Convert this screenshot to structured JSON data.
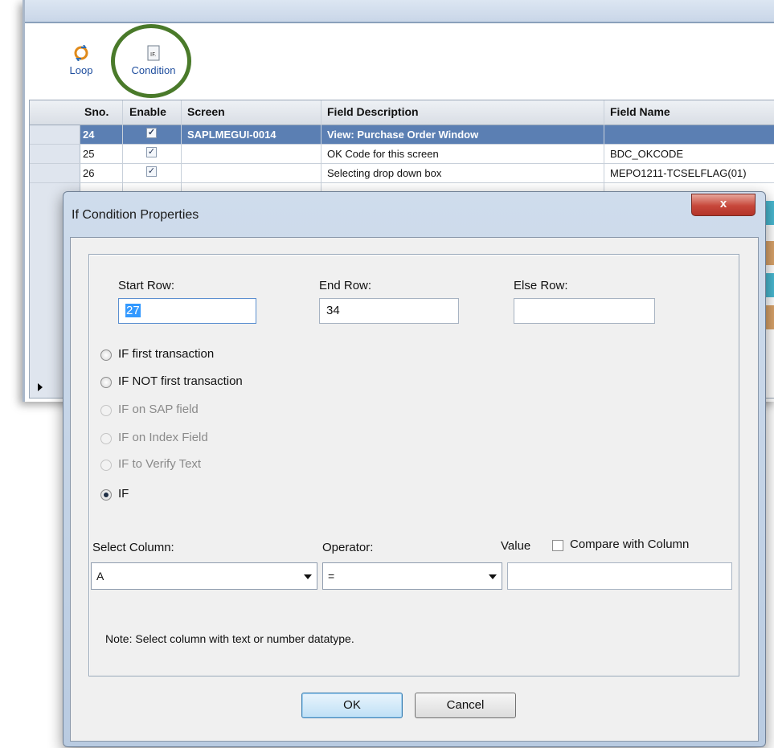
{
  "toolbar": {
    "loop_label": "Loop",
    "condition_label": "Condition"
  },
  "grid": {
    "headers": {
      "sno": "Sno.",
      "enable": "Enable",
      "screen": "Screen",
      "field_description": "Field Description",
      "field_name": "Field Name"
    },
    "rows": [
      {
        "sno": "24",
        "screen": "SAPLMEGUI-0014",
        "field_description": "View: Purchase Order Window",
        "field_name": ""
      },
      {
        "sno": "25",
        "screen": "",
        "field_description": "OK Code for this screen",
        "field_name": "BDC_OKCODE"
      },
      {
        "sno": "26",
        "screen": "",
        "field_description": "Selecting drop down box",
        "field_name": "MEPO1211-TCSELFLAG(01)"
      }
    ]
  },
  "dialog": {
    "title": "If Condition Properties",
    "close_label": "x",
    "start_row_label": "Start Row:",
    "start_row_value": "27",
    "end_row_label": "End Row:",
    "end_row_value": "34",
    "else_row_label": "Else Row:",
    "else_row_value": "",
    "options": [
      {
        "label": "IF first transaction",
        "enabled": true,
        "checked": false
      },
      {
        "label": "IF NOT first transaction",
        "enabled": true,
        "checked": false
      },
      {
        "label": "IF on SAP field",
        "enabled": false,
        "checked": false
      },
      {
        "label": "IF on Index Field",
        "enabled": false,
        "checked": false
      },
      {
        "label": "IF to Verify Text",
        "enabled": false,
        "checked": false
      },
      {
        "label": "IF",
        "enabled": true,
        "checked": true
      }
    ],
    "select_column_label": "Select Column:",
    "select_column_value": "A",
    "operator_label": "Operator:",
    "operator_value": "=",
    "value_label": "Value",
    "value_value": "",
    "compare_with_column_label": "Compare with Column",
    "note": "Note: Select column with text or number datatype.",
    "ok_label": "OK",
    "cancel_label": "Cancel"
  },
  "colors": {
    "selected_row": "#5b7fb3",
    "highlight_ring": "#4a7a2a",
    "close_button": "#c7473a"
  }
}
